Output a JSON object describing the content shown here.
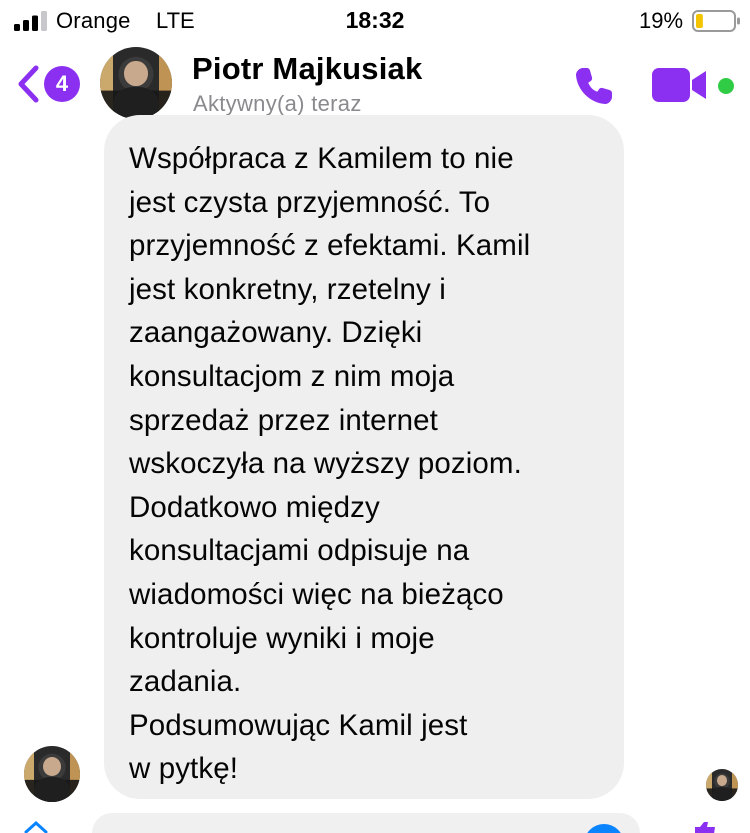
{
  "status_bar": {
    "carrier": "Orange",
    "network": "LTE",
    "time": "18:32",
    "battery_percent": "19%",
    "battery_level": 0.19
  },
  "header": {
    "back_badge_count": "4",
    "contact_name": "Piotr Majkusiak",
    "contact_status": "Aktywny(a) teraz",
    "accent_color": "#8b2ff0",
    "online_color": "#31cc46"
  },
  "message": {
    "text": "Współpraca z Kamilem to nie\njest czysta przyjemność. To\nprzyjemność z efektami. Kamil\njest konkretny, rzetelny i\nzaangażowany. Dzięki\nkonsultacjom z nim moja\nsprzedaż przez internet\nwskoczyła na wyższy poziom.\nDodatkowo między\nkonsultacjami odpisuje na\nwiadomości więc na bieżąco\nkontroluje wyniki i moje\nzadania.\nPodsumowując Kamil jest\nw pytkę!"
  },
  "icons": {
    "back": "chevron-left-icon",
    "call": "phone-icon",
    "video": "video-camera-icon",
    "signal": "signal-bars-icon",
    "battery": "battery-icon"
  }
}
